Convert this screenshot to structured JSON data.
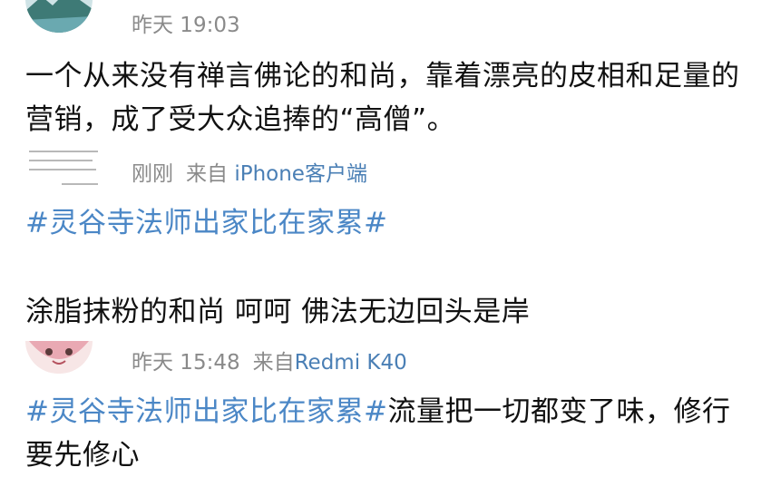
{
  "post1": {
    "time": "昨天 19:03",
    "text": "一个从来没有禅言佛论的和尚，靠着漂亮的皮相和足量的营销，成了受大众追捧的“高僧”。"
  },
  "post2": {
    "time": "刚刚",
    "source_prefix": "来自",
    "device": "iPhone客户端",
    "hashtag": "#灵谷寺法师出家比在家累#"
  },
  "post3": {
    "text": "涂脂抹粉的和尚 呵呵 佛法无边回头是岸"
  },
  "post4": {
    "time": "昨天 15:48",
    "source_prefix": "来自",
    "device": "Redmi K40",
    "hashtag": "#灵谷寺法师出家比在家累#",
    "text": "流量把一切都变了味，修行要先修心"
  },
  "colors": {
    "hashtag": "#4b87c6",
    "meta": "#8a8a8a",
    "body": "#111111"
  }
}
